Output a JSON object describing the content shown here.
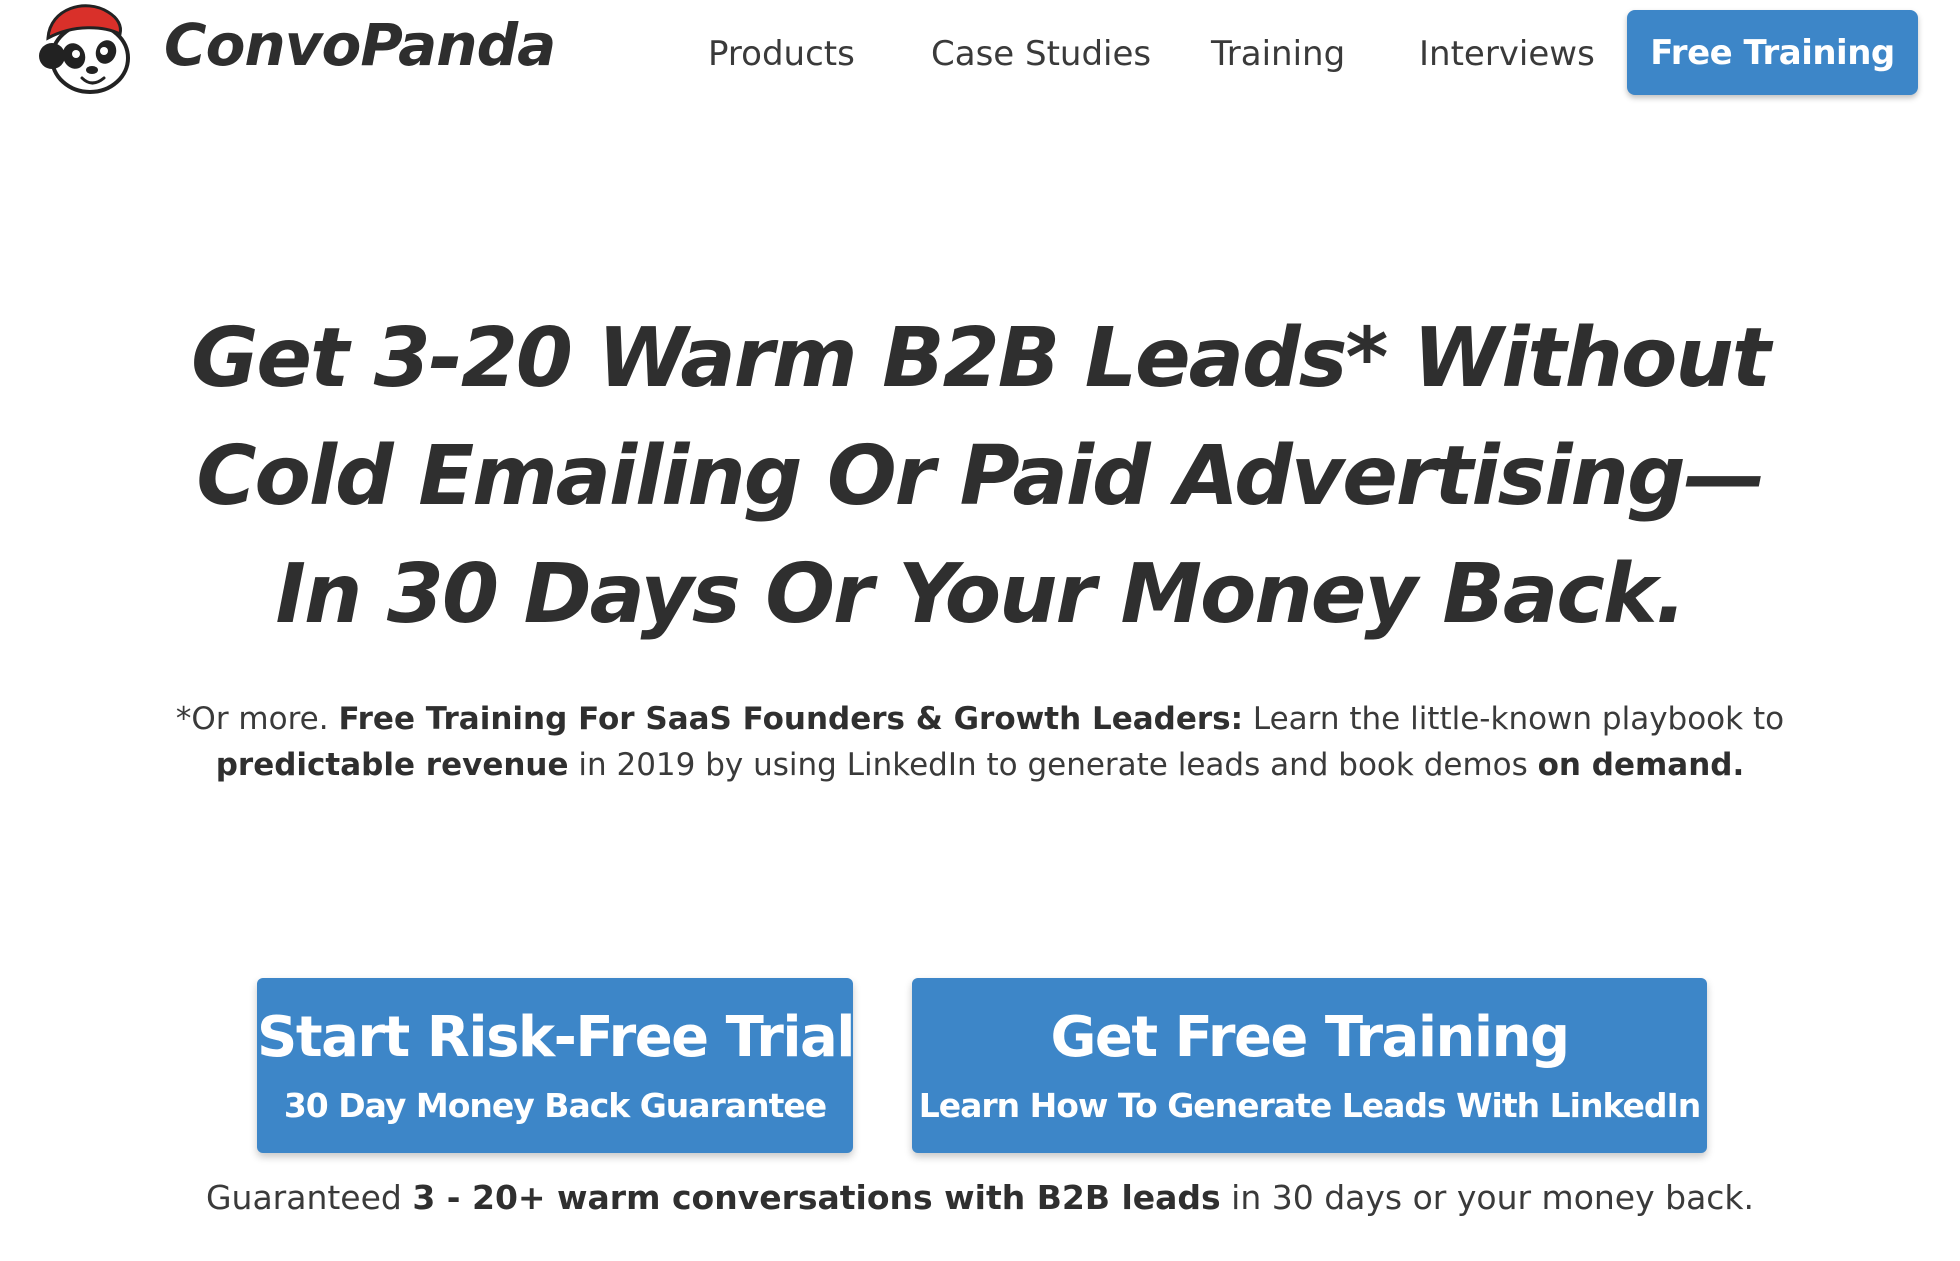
{
  "brand": {
    "name": "ConvoPanda"
  },
  "nav": {
    "items": [
      {
        "label": "Products"
      },
      {
        "label": "Case Studies"
      },
      {
        "label": "Training"
      },
      {
        "label": "Interviews"
      }
    ],
    "cta_label": "Free Training"
  },
  "hero": {
    "headline_lines": [
      "Get 3-20 Warm B2B Leads* Without",
      "Cold Emailing Or Paid Advertising—",
      "In 30 Days Or Your Money Back."
    ],
    "sub": {
      "part1": "*Or more. ",
      "bold1": "Free Training For SaaS Founders & Growth Leaders:",
      "part2": " Learn the little-known playbook to",
      "bold2": "predictable revenue",
      "part3": " in 2019 by using LinkedIn to generate leads and book demos ",
      "bold3": "on demand."
    }
  },
  "cta_buttons": {
    "trial": {
      "title": "Start Risk-Free Trial",
      "subtitle": "30 Day Money Back Guarantee"
    },
    "training": {
      "title": "Get Free Training",
      "subtitle": "Learn How To Generate Leads With LinkedIn"
    }
  },
  "guarantee": {
    "part1": "Guaranteed ",
    "bold": "3 - 20+ warm conversations with B2B leads",
    "part2": " in 30 days or your money back."
  },
  "colors": {
    "accent": "#3d86c8",
    "text": "#333333",
    "logo_hat": "#d9302a"
  },
  "icons": {
    "logo": "panda-logo-icon"
  }
}
